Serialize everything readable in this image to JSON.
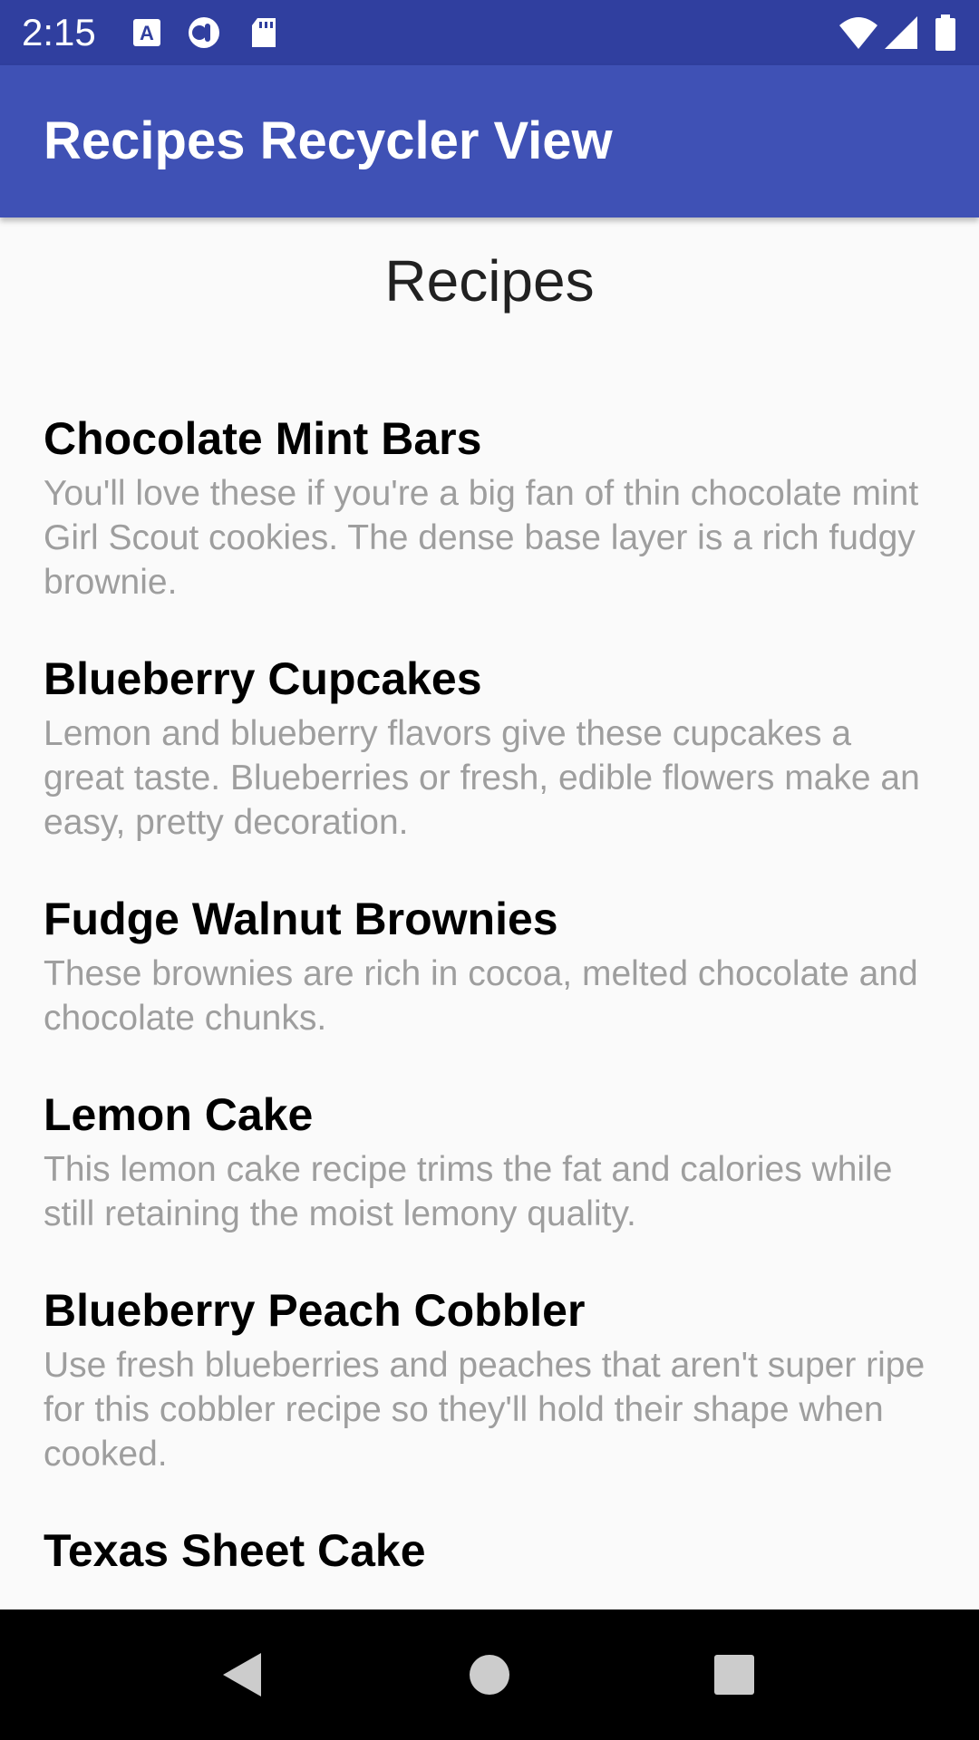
{
  "status_bar": {
    "time": "2:15",
    "background": "#303f9f",
    "icons": [
      "font-app-icon",
      "app-circle-icon",
      "sd-card-icon",
      "wifi-icon",
      "signal-icon",
      "battery-icon"
    ]
  },
  "app_bar": {
    "title": "Recipes Recycler View",
    "background": "#3f51b5"
  },
  "main": {
    "heading": "Recipes",
    "recipes": [
      {
        "title": "Chocolate Mint Bars",
        "description": "You'll love these if you're a big fan of thin chocolate mint Girl Scout cookies. The dense base layer is a rich fudgy brownie."
      },
      {
        "title": "Blueberry Cupcakes",
        "description": "Lemon and blueberry flavors give these cupcakes a great taste. Blueberries or fresh, edible flowers make an easy, pretty decoration."
      },
      {
        "title": "Fudge Walnut Brownies",
        "description": "These brownies are rich in cocoa, melted chocolate and chocolate chunks."
      },
      {
        "title": "Lemon Cake",
        "description": "This lemon cake recipe trims the fat and calories while still retaining the moist lemony quality."
      },
      {
        "title": "Blueberry Peach Cobbler",
        "description": "Use fresh blueberries and peaches that aren't super ripe for this cobbler recipe so they'll hold their shape when cooked."
      },
      {
        "title": "Texas Sheet Cake",
        "description": ""
      }
    ]
  },
  "nav_bar": {
    "buttons": [
      "back-icon",
      "home-icon",
      "recents-icon"
    ]
  }
}
